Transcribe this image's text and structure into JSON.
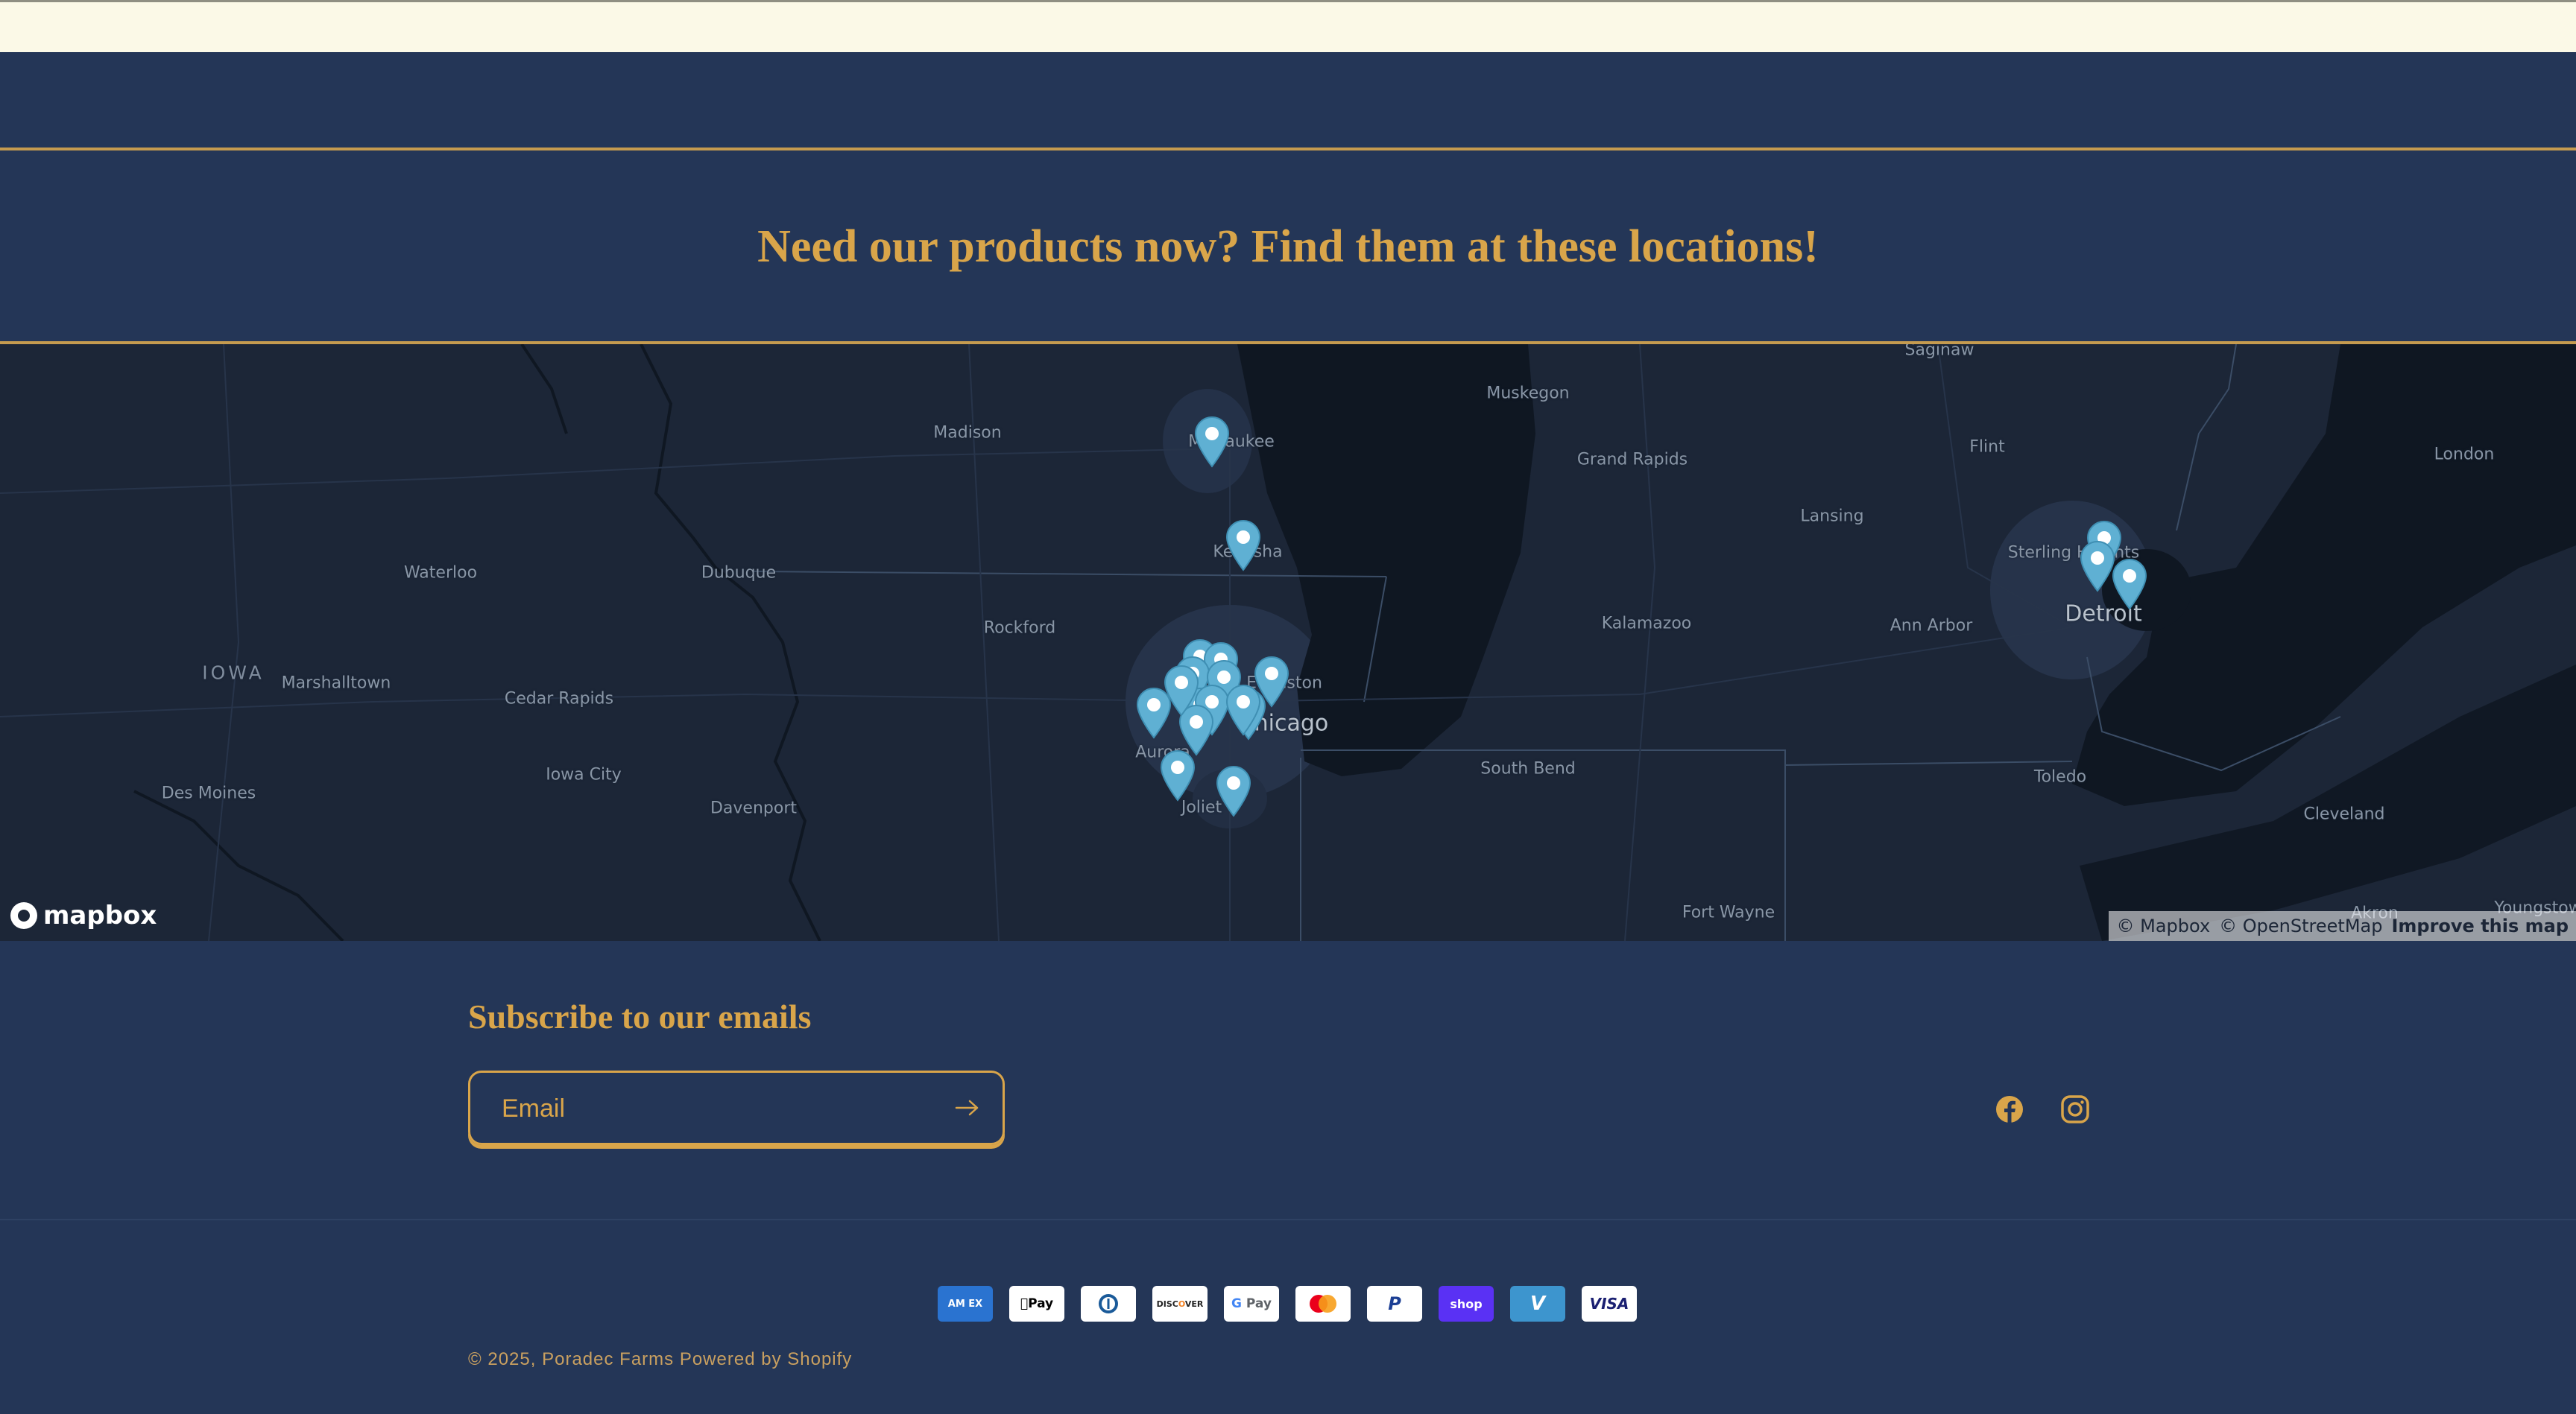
{
  "headline": "Need our products now? Find them at these locations!",
  "map": {
    "labels": {
      "saginaw": "Saginaw",
      "muskegon": "Muskegon",
      "madison": "Madison",
      "milwaukee": "Milwaukee",
      "grand_rapids": "Grand Rapids",
      "flint": "Flint",
      "london": "London",
      "lansing": "Lansing",
      "kenosha": "Kenosha",
      "sterling_heights": "Sterling Heights",
      "waterloo": "Waterloo",
      "dubuque": "Dubuque",
      "rockford": "Rockford",
      "kalamazoo": "Kalamazoo",
      "ann_arbor": "Ann Arbor",
      "detroit": "Detroit",
      "iowa": "IOWA",
      "marshalltown": "Marshalltown",
      "evanston": "Evanston",
      "cedar_rapids": "Cedar Rapids",
      "chicago": "Chicago",
      "iowa_city": "Iowa City",
      "aurora": "Aurora",
      "south_bend": "South Bend",
      "toledo": "Toledo",
      "des_moines": "Des Moines",
      "joliet": "Joliet",
      "davenport": "Davenport",
      "cleveland": "Cleveland",
      "akron": "Akron",
      "fort_wayne": "Fort Wayne",
      "youngstown": "Youngstown"
    },
    "logo_text": "mapbox",
    "attribution": {
      "mapbox": "© Mapbox",
      "osm": "© OpenStreetMap",
      "improve": "Improve this map"
    },
    "pin_color": "#5fb0d3"
  },
  "subscribe": {
    "title": "Subscribe to our emails",
    "email_placeholder": "Email"
  },
  "social": [
    "facebook-icon",
    "instagram-icon"
  ],
  "payments": [
    "American Express",
    "Apple Pay",
    "Diners Club",
    "Discover",
    "Google Pay",
    "Mastercard",
    "PayPal",
    "Shop Pay",
    "Venmo",
    "Visa"
  ],
  "footer": {
    "copyright_prefix": "© 2025,",
    "store_name": "Poradec Farms",
    "powered_by": "Powered by Shopify"
  },
  "colors": {
    "navy": "#243657",
    "gold": "#d9a54a",
    "cream": "#fbf9e7",
    "map_land": "#1c2637",
    "map_water": "#0f1722"
  }
}
